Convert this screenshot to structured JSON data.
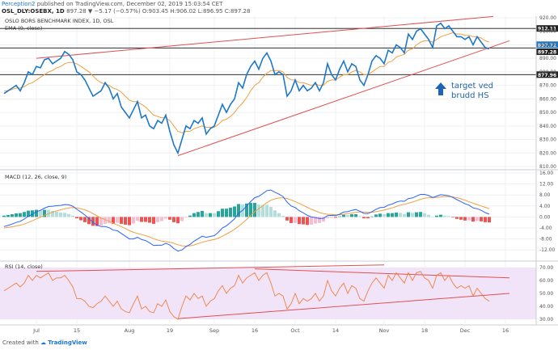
{
  "header": {
    "author": "Perception2",
    "published_text": "published on TradingView.com, December 02, 2019 15:03:54 CET",
    "symbol": "OSL_DLY:OSEBX, 1D",
    "ohlc": "897.28 ▼ −5.17 (−0.57%) O:903.45 H:906.02 L:896.95 C:897.28",
    "index_name": "OSLO BORS BENCHMARK INDEX, 1D, OSL",
    "ema_label": "EMA (9, close)"
  },
  "footer": {
    "prefix": "Created with",
    "brand": "TradingView"
  },
  "annotation": {
    "line1": "target ved",
    "line2": "brudd HS"
  },
  "colors": {
    "price": "#1e78c8",
    "ema": "#f0a040",
    "trend": "#e05050",
    "macd": "#2962ff",
    "signal": "#f0a040",
    "hist_pos_strong": "#26a69a",
    "hist_pos_weak": "#b2dfdb",
    "hist_neg_strong": "#ef5350",
    "hist_neg_weak": "#f8bbd0",
    "rsi": "#f08040",
    "rsi_band": "#f1e4f8",
    "label_bg": "#222222"
  },
  "chart_data": [
    {
      "type": "line",
      "title": "OSLO BORS BENCHMARK INDEX, 1D, OSL",
      "ylim": [
        810,
        920
      ],
      "yticks": [
        810,
        820,
        830,
        840,
        850,
        860,
        870,
        880,
        890,
        900,
        910,
        920
      ],
      "x_tick_labels": [
        {
          "label": "Jul",
          "i": 8
        },
        {
          "label": "15",
          "i": 18
        },
        {
          "label": "Aug",
          "i": 31
        },
        {
          "label": "19",
          "i": 41
        },
        {
          "label": "Sep",
          "i": 52
        },
        {
          "label": "16",
          "i": 62
        },
        {
          "label": "Oct",
          "i": 72
        },
        {
          "label": "14",
          "i": 82
        },
        {
          "label": "Nov",
          "i": 94
        },
        {
          "label": "18",
          "i": 104
        },
        {
          "label": "Dec",
          "i": 114
        },
        {
          "label": "16",
          "i": 124
        }
      ],
      "series": [
        {
          "name": "OSEBX",
          "values": [
            864,
            866,
            868,
            870,
            866,
            872,
            880,
            878,
            884,
            883,
            889,
            890,
            886,
            888,
            890,
            895,
            893,
            889,
            880,
            878,
            874,
            868,
            862,
            864,
            866,
            872,
            868,
            860,
            864,
            854,
            850,
            846,
            852,
            858,
            846,
            848,
            840,
            838,
            844,
            842,
            848,
            836,
            826,
            820,
            830,
            840,
            838,
            844,
            842,
            846,
            834,
            838,
            840,
            848,
            856,
            850,
            856,
            860,
            872,
            868,
            878,
            884,
            888,
            882,
            890,
            894,
            888,
            878,
            880,
            878,
            862,
            866,
            874,
            866,
            870,
            866,
            868,
            872,
            866,
            872,
            886,
            878,
            874,
            882,
            888,
            880,
            886,
            884,
            874,
            870,
            878,
            888,
            892,
            890,
            886,
            896,
            894,
            900,
            898,
            894,
            908,
            904,
            910,
            912,
            908,
            904,
            898,
            914,
            916,
            912,
            914,
            910,
            906,
            906,
            904,
            906,
            900,
            906,
            902,
            898,
            897
          ]
        },
        {
          "name": "EMA (9, close)",
          "values": [
            866,
            866,
            867,
            868,
            868,
            869,
            871,
            872,
            874,
            876,
            878,
            880,
            881,
            883,
            884,
            886,
            887,
            887,
            886,
            884,
            882,
            880,
            877,
            874,
            872,
            871,
            870,
            868,
            867,
            865,
            862,
            859,
            858,
            858,
            856,
            854,
            851,
            848,
            847,
            846,
            846,
            844,
            840,
            836,
            835,
            836,
            836,
            838,
            839,
            840,
            839,
            839,
            839,
            841,
            844,
            845,
            847,
            850,
            854,
            857,
            861,
            866,
            870,
            872,
            876,
            879,
            881,
            881,
            881,
            880,
            876,
            874,
            874,
            872,
            872,
            871,
            870,
            871,
            870,
            870,
            873,
            874,
            874,
            876,
            878,
            878,
            880,
            881,
            880,
            878,
            878,
            880,
            882,
            884,
            884,
            887,
            888,
            891,
            892,
            893,
            896,
            897,
            900,
            902,
            903,
            903,
            902,
            904,
            906,
            907,
            908,
            909,
            908,
            908,
            907,
            907,
            906,
            906,
            905,
            903,
            902
          ]
        }
      ],
      "price_levels": [
        {
          "label": "912.11",
          "value": 912.11
        },
        {
          "label": "897.72",
          "value": 897.72
        },
        {
          "label": "897.28",
          "value": 897.28
        },
        {
          "label": "877.96",
          "value": 877.96
        }
      ],
      "trendlines": [
        {
          "i1": 8,
          "y1": 890,
          "i2": 121,
          "y2": 921
        },
        {
          "i1": 43,
          "y1": 818,
          "i2": 125,
          "y2": 903
        }
      ]
    },
    {
      "type": "bar",
      "title": "MACD (12, 26, close, 9)",
      "ylim": [
        -14,
        16
      ],
      "yticks": [
        -12,
        -8,
        -4,
        0,
        4,
        8,
        12,
        16
      ],
      "series": [
        {
          "name": "MACD",
          "values": [
            -3.5,
            -3.1,
            -2.6,
            -2.0,
            -1.6,
            -0.8,
            0.3,
            1.0,
            1.9,
            2.4,
            3.2,
            3.8,
            3.9,
            4.1,
            4.2,
            4.5,
            4.4,
            3.9,
            2.8,
            1.8,
            0.7,
            -0.6,
            -2.0,
            -2.9,
            -3.5,
            -3.5,
            -3.9,
            -4.8,
            -5.0,
            -6.0,
            -7.0,
            -8.0,
            -8.0,
            -7.4,
            -8.2,
            -8.6,
            -9.4,
            -10.4,
            -10.3,
            -10.3,
            -9.6,
            -10.2,
            -11.5,
            -12.4,
            -12.0,
            -10.8,
            -10.0,
            -8.8,
            -7.9,
            -7.0,
            -7.4,
            -7.1,
            -6.8,
            -5.6,
            -4.0,
            -3.2,
            -2.0,
            -0.7,
            1.3,
            2.4,
            4.0,
            5.6,
            7.0,
            7.5,
            8.5,
            9.6,
            9.8,
            9.0,
            8.3,
            7.4,
            5.4,
            4.0,
            3.4,
            2.3,
            1.5,
            0.6,
            0.0,
            -0.2,
            -0.6,
            -0.5,
            0.5,
            0.6,
            0.5,
            1.0,
            1.8,
            1.9,
            2.4,
            2.7,
            2.1,
            1.3,
            1.2,
            1.9,
            2.8,
            3.4,
            3.5,
            4.3,
            4.7,
            5.4,
            5.8,
            5.7,
            6.7,
            6.9,
            7.6,
            8.2,
            8.2,
            7.8,
            7.1,
            7.6,
            8.1,
            7.9,
            7.7,
            7.1,
            6.3,
            5.6,
            4.8,
            4.3,
            3.3,
            3.0,
            2.4,
            1.6,
            1.0
          ]
        },
        {
          "name": "Signal",
          "values": [
            -4.0,
            -3.8,
            -3.6,
            -3.3,
            -3.0,
            -2.6,
            -2.0,
            -1.4,
            -0.7,
            -0.1,
            0.6,
            1.2,
            1.7,
            2.2,
            2.6,
            3.0,
            3.3,
            3.4,
            3.3,
            3.0,
            2.6,
            2.0,
            1.2,
            0.4,
            -0.4,
            -1.0,
            -1.6,
            -2.3,
            -2.9,
            -3.5,
            -4.2,
            -5.0,
            -5.6,
            -6.0,
            -6.4,
            -6.8,
            -7.3,
            -7.9,
            -8.4,
            -8.8,
            -9.0,
            -9.2,
            -9.6,
            -10.1,
            -10.5,
            -10.6,
            -10.5,
            -10.2,
            -9.7,
            -9.2,
            -8.8,
            -8.5,
            -8.2,
            -7.7,
            -7.0,
            -6.2,
            -5.4,
            -4.5,
            -3.4,
            -2.2,
            -0.9,
            0.5,
            1.9,
            3.0,
            4.1,
            5.2,
            6.1,
            6.6,
            6.9,
            7.0,
            6.7,
            6.2,
            5.6,
            4.9,
            4.2,
            3.5,
            2.8,
            2.2,
            1.6,
            1.2,
            1.0,
            0.9,
            0.8,
            0.8,
            1.0,
            1.2,
            1.4,
            1.7,
            1.8,
            1.8,
            1.7,
            1.7,
            1.9,
            2.2,
            2.5,
            2.9,
            3.3,
            3.8,
            4.3,
            4.6,
            5.0,
            5.4,
            5.9,
            6.4,
            6.8,
            7.0,
            7.0,
            7.1,
            7.3,
            7.4,
            7.4,
            7.3,
            7.0,
            6.6,
            6.1,
            5.5,
            5.0,
            4.5,
            4.0,
            3.5,
            3.0
          ]
        }
      ]
    },
    {
      "type": "line",
      "title": "RSI (14, close)",
      "ylim": [
        30,
        70
      ],
      "yticks": [
        30,
        40,
        50,
        60,
        70
      ],
      "band": [
        30,
        70
      ],
      "series": [
        {
          "name": "RSI",
          "values": [
            52,
            54,
            56,
            58,
            55,
            58,
            64,
            60,
            64,
            62,
            64,
            66,
            60,
            62,
            62,
            64,
            60,
            55,
            46,
            46,
            44,
            40,
            39,
            42,
            44,
            48,
            44,
            40,
            44,
            38,
            36,
            35,
            42,
            48,
            38,
            40,
            36,
            35,
            42,
            40,
            45,
            36,
            32,
            30,
            40,
            48,
            45,
            50,
            46,
            48,
            40,
            44,
            46,
            52,
            56,
            50,
            54,
            56,
            64,
            58,
            62,
            64,
            66,
            60,
            64,
            66,
            58,
            48,
            50,
            48,
            38,
            42,
            50,
            42,
            46,
            44,
            46,
            50,
            44,
            48,
            60,
            52,
            48,
            54,
            58,
            50,
            56,
            54,
            46,
            44,
            52,
            58,
            62,
            58,
            54,
            64,
            60,
            66,
            62,
            58,
            66,
            60,
            66,
            67,
            62,
            60,
            54,
            64,
            66,
            60,
            64,
            58,
            54,
            56,
            54,
            56,
            48,
            54,
            50,
            46,
            44
          ]
        }
      ],
      "trendlines": [
        {
          "i1": 8,
          "y1": 67,
          "i2": 94,
          "y2": 72
        },
        {
          "i1": 62,
          "y1": 69,
          "i2": 125,
          "y2": 62
        },
        {
          "i1": 43,
          "y1": 30.5,
          "i2": 125,
          "y2": 50
        }
      ]
    }
  ]
}
